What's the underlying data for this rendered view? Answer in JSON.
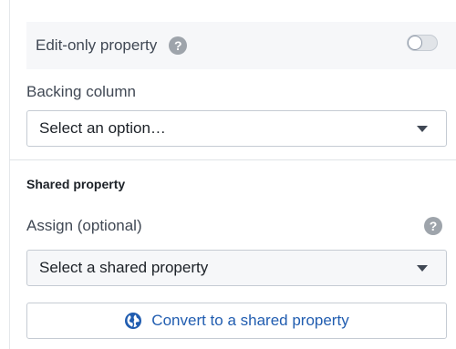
{
  "edit_only": {
    "label": "Edit-only property",
    "help_glyph": "?",
    "toggle_on": false
  },
  "backing_column": {
    "label": "Backing column",
    "value": "Select an option…"
  },
  "shared_property": {
    "section_title": "Shared property",
    "assign_label": "Assign (optional)",
    "help_glyph": "?",
    "select_value": "Select a shared property",
    "convert_button_label": "Convert to a shared property"
  },
  "colors": {
    "link_blue": "#215db0",
    "help_grey": "#9ea4ab",
    "row_background": "#f6f7f9"
  },
  "icons": {
    "help": "help-icon",
    "caret": "chevron-down-icon",
    "convert": "globe-icon"
  }
}
